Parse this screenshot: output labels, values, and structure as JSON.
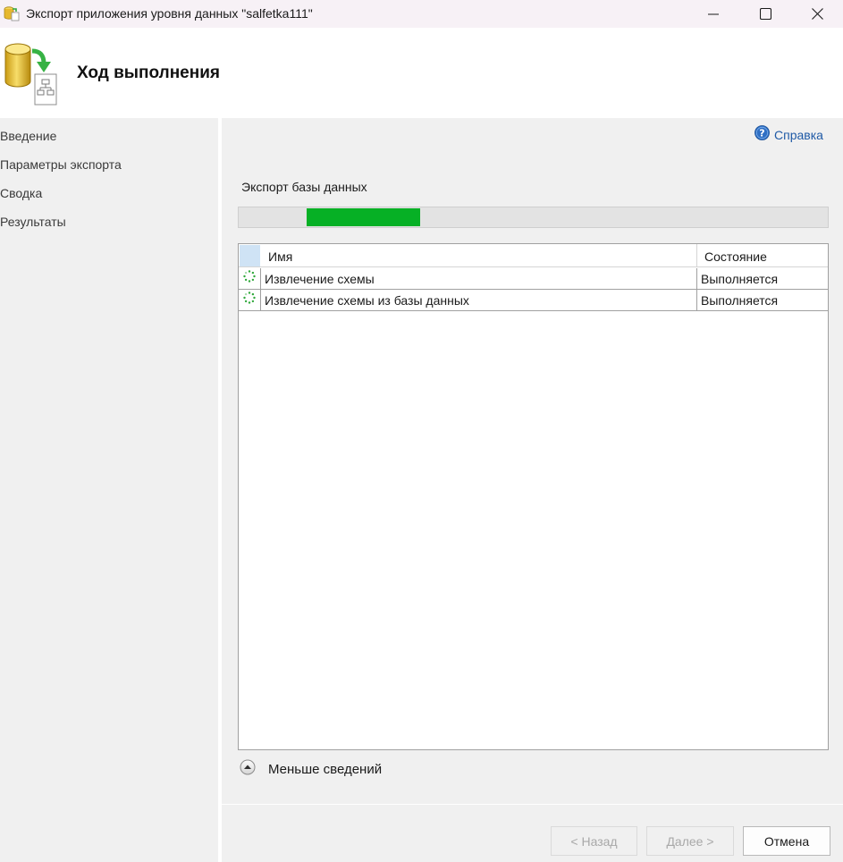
{
  "window": {
    "title": "Экспорт приложения уровня данных \"salfetka111\"",
    "app_icon": "database-export-icon",
    "controls": [
      "minimize-icon",
      "maximize-icon",
      "close-icon"
    ]
  },
  "header": {
    "heading": "Ход выполнения",
    "icon": "database-to-document-icon"
  },
  "nav": {
    "items": [
      {
        "label": "Введение"
      },
      {
        "label": "Параметры экспорта"
      },
      {
        "label": "Сводка"
      },
      {
        "label": "Результаты"
      }
    ]
  },
  "main": {
    "help_label": "Справка",
    "help_icon": "help-icon",
    "operation_label": "Экспорт базы данных",
    "progress": {
      "fill_start": 0.115,
      "fill_end": 0.307,
      "color": "#06b025"
    },
    "table": {
      "columns": {
        "name": "Имя",
        "state": "Состояние"
      },
      "rows": [
        {
          "name": "Извлечение схемы",
          "state": "Выполняется",
          "icon": "spinner-icon"
        },
        {
          "name": "Извлечение схемы из базы данных",
          "state": "Выполняется",
          "icon": "spinner-icon"
        }
      ]
    },
    "less_details_label": "Меньше сведений",
    "less_details_icon": "collapse-up-icon"
  },
  "buttons": {
    "back": "< Назад",
    "next": "Далее >",
    "cancel": "Отмена"
  }
}
